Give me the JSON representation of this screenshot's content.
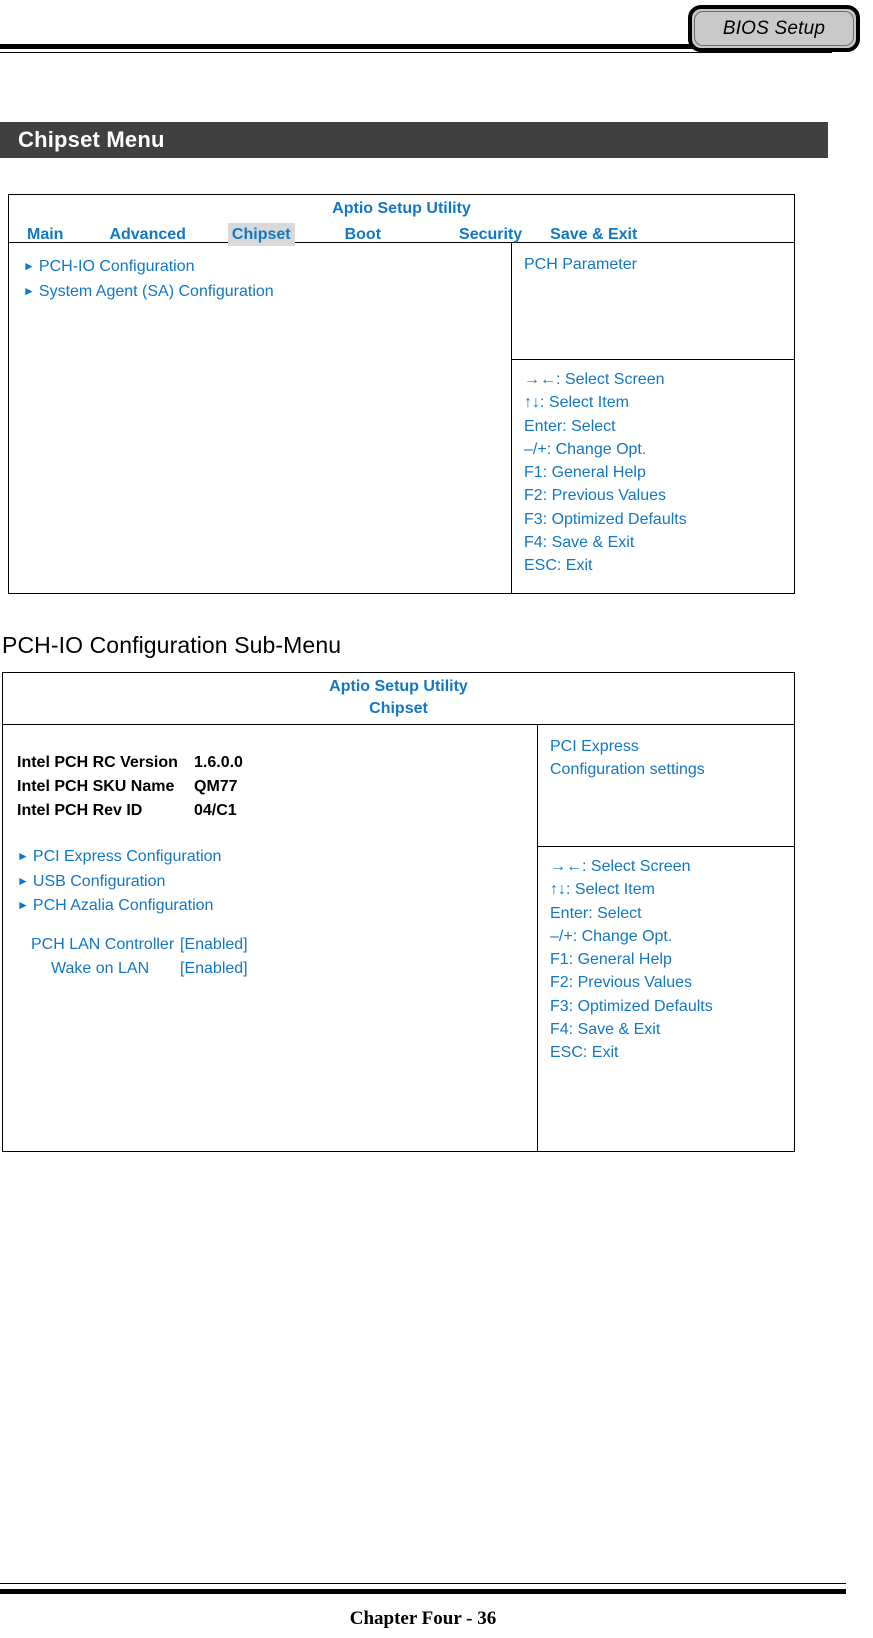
{
  "header": {
    "bios_tab_label": "BIOS Setup"
  },
  "section": {
    "banner_title": "Chipset Menu"
  },
  "submenu": {
    "heading": "PCH-IO Configuration Sub-Menu"
  },
  "colors": {
    "bios_blue": "#1277C4",
    "banner_bg": "#404040",
    "tab_highlight": "#D9D9D9",
    "bios_tab_fill": "#C9C9C9"
  },
  "screen1": {
    "utility_title": "Aptio Setup Utility",
    "tabs": [
      {
        "label": "Main",
        "active": false
      },
      {
        "label": "Advanced",
        "active": false
      },
      {
        "label": "Chipset",
        "active": true
      },
      {
        "label": "Boot",
        "active": false
      },
      {
        "label": "Security",
        "active": false
      },
      {
        "label": "Save & Exit",
        "active": false
      }
    ],
    "nav_items": [
      {
        "arrow": "►",
        "label": "PCH-IO Configuration"
      },
      {
        "arrow": "►",
        "label": "System Agent (SA) Configuration"
      }
    ],
    "help_text": "PCH Parameter",
    "keys": [
      "→←: Select Screen",
      "↑↓: Select Item",
      "Enter: Select",
      "–/+: Change Opt.",
      "F1: General Help",
      "F2: Previous Values",
      "F3: Optimized Defaults",
      "F4: Save & Exit",
      "ESC: Exit"
    ]
  },
  "screen2": {
    "utility_title": "Aptio Setup Utility",
    "utility_sub": "Chipset",
    "info_rows": [
      {
        "label": "Intel PCH RC Version",
        "value": "1.6.0.0"
      },
      {
        "label": "Intel PCH SKU Name",
        "value": "QM77"
      },
      {
        "label": "Intel PCH Rev ID",
        "value": "04/C1"
      }
    ],
    "nav_items": [
      {
        "arrow": "►",
        "label": "PCI Express Configuration"
      },
      {
        "arrow": "►",
        "label": "USB Configuration"
      },
      {
        "arrow": "►",
        "label": "PCH Azalia Configuration"
      }
    ],
    "options": [
      {
        "label": "PCH LAN Controller",
        "value": "[Enabled]",
        "indent": 1
      },
      {
        "label": "Wake on LAN",
        "value": "[Enabled]",
        "indent": 2
      }
    ],
    "help_lines": [
      "PCI Express",
      "Configuration settings"
    ],
    "keys": [
      "→←: Select Screen",
      "↑↓: Select Item",
      "Enter: Select",
      "–/+: Change Opt.",
      "F1: General Help",
      "F2: Previous Values",
      "F3: Optimized Defaults",
      "F4: Save & Exit",
      "ESC: Exit"
    ]
  },
  "footer": {
    "text": "Chapter Four - 36"
  }
}
